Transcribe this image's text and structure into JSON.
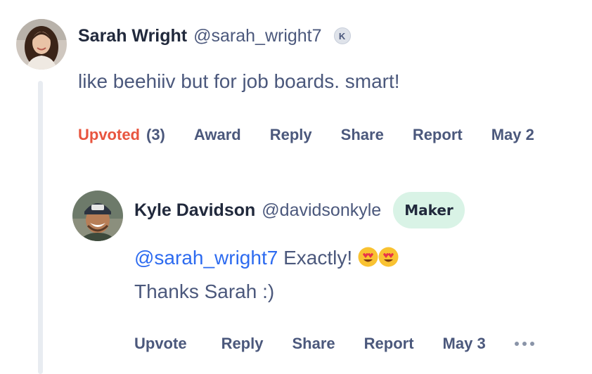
{
  "comments": [
    {
      "author": "Sarah Wright",
      "handle": "@sarah_wright7",
      "karma_badge": "K",
      "body": "like beehiiv but for job boards. smart!",
      "actions": {
        "upvote_label": "Upvoted",
        "upvote_count": "(3)",
        "award": "Award",
        "reply": "Reply",
        "share": "Share",
        "report": "Report",
        "date": "May 2"
      }
    },
    {
      "author": "Kyle Davidson",
      "handle": "@davidsonkyle",
      "badge": "Maker",
      "mention": "@sarah_wright7",
      "body_line1_text": "Exactly!",
      "body_line2": "Thanks Sarah :)",
      "actions": {
        "upvote": "Upvote",
        "reply": "Reply",
        "share": "Share",
        "report": "Report",
        "date": "May 3"
      }
    }
  ],
  "icons": {
    "emoji": "heart-eyes-emoji-icon",
    "more": "more-dots-icon",
    "karma": "karma-badge-icon"
  },
  "colors": {
    "upvoted": "#e8553f",
    "mention": "#2d6bf0",
    "maker_badge_bg": "#d9f3e6",
    "secondary_text": "#4b587c",
    "primary_text": "#21293c"
  }
}
